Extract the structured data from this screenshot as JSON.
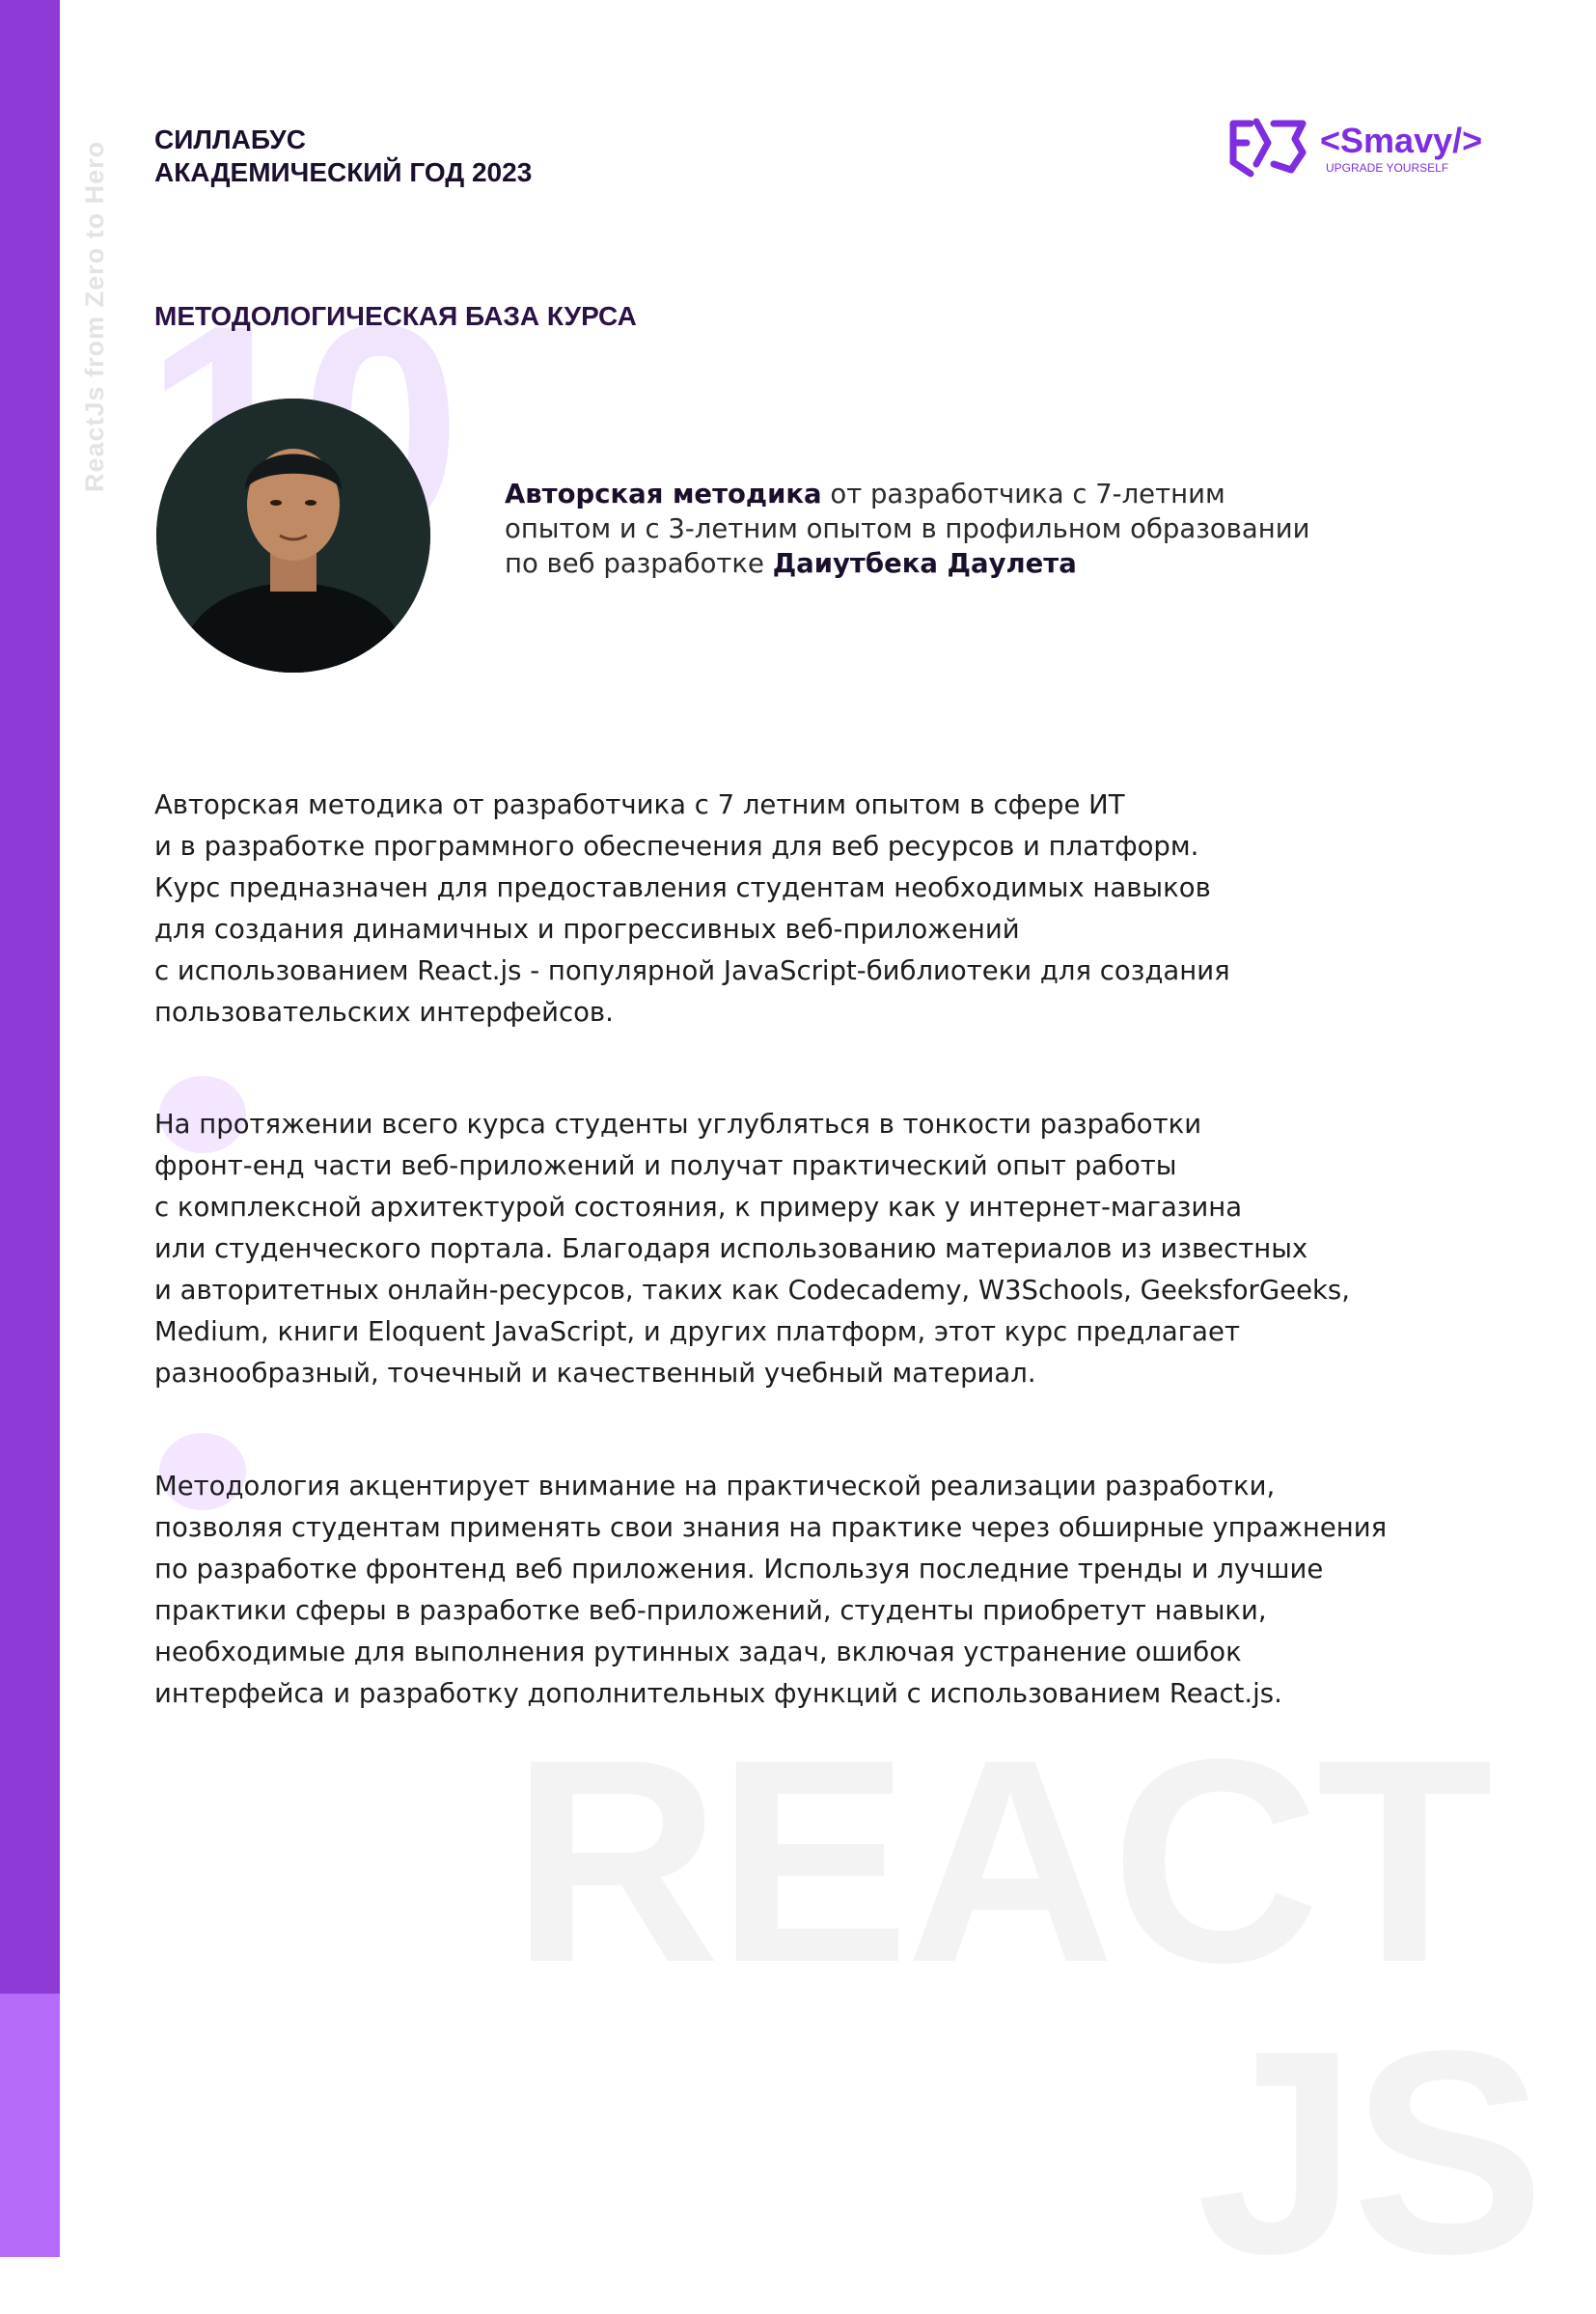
{
  "sidebar": {
    "vertical_text": "ReactJs from Zero to Hero"
  },
  "header": {
    "title_line1": "СИЛЛАБУС",
    "title_line2": "АКАДЕМИЧЕСКИЙ ГОД 2023",
    "logo": {
      "brand": "<Smavy/>",
      "tagline": "UPGRADE YOURSELF"
    }
  },
  "section": {
    "number": "10",
    "title": "МЕТОДОЛОГИЧЕСКАЯ БАЗА КУРСА"
  },
  "author": {
    "bold1": "Авторская методика",
    "text1": " от разработчика с 7-летним",
    "line2": "опытом и с 3-летним опытом в профильном образовании",
    "text3": "по веб разработке ",
    "bold3": "Даиутбека Даулета"
  },
  "paragraphs": {
    "p1": [
      "Авторская методика от разработчика с 7 летним опытом в сфере ИТ",
      "и в разработке программного обеспечения для веб ресурсов и платформ.",
      "Курс предназначен для предоставления студентам необходимых навыков",
      "для создания динамичных и прогрессивных веб-приложений",
      "с использованием React.js - популярной JavaScript-библиотеки для создания",
      "пользовательских интерфейсов."
    ],
    "p2": [
      "На протяжении всего курса студенты углубляться в тонкости разработки",
      "фронт-енд части веб-приложений и получат практический опыт работы",
      "с комплексной архитектурой состояния, к примеру как у интернет-магазина",
      "или студенческого портала. Благодаря использованию материалов из известных",
      "и авторитетных онлайн-ресурсов, таких как Codecademy, W3Schools, GeeksforGeeks,",
      "Medium, книги Eloquent JavaScript, и других платформ, этот курс предлагает",
      "разнообразный, точечный и качественный учебный материал."
    ],
    "p3": [
      "Методология акцентирует внимание на практической реализации разработки,",
      "позволяя студентам применять свои знания на практике через обширные упражнения",
      "по разработке фронтенд веб приложения. Используя последние тренды и лучшие",
      "практики сферы в разработке веб-приложений, студенты приобретут навыки,",
      "необходимые для выполнения рутинных задач, включая устранение ошибок",
      "интерфейса и разработку дополнительных функций с использованием React.js."
    ]
  },
  "watermark": {
    "line1": "REACT",
    "line2": "JS"
  },
  "colors": {
    "accent": "#8d3ad6",
    "accent_light": "#b76cf9",
    "heading": "#2c1147",
    "logo": "#7e2ee0"
  }
}
